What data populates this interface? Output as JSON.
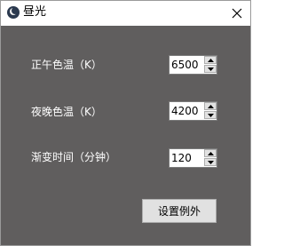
{
  "window": {
    "title": "昼光",
    "app_icon": "moon-icon",
    "close_icon": "close-icon"
  },
  "settings": {
    "noon_temp": {
      "label": "正午色温（K）",
      "value": "6500"
    },
    "night_temp": {
      "label": "夜晚色温（K）",
      "value": "4200"
    },
    "transition_time": {
      "label": "渐变时间（分钟）",
      "value": "120"
    }
  },
  "buttons": {
    "exceptions": "设置例外"
  },
  "colors": {
    "client_background": "#605e5e",
    "label_text": "#ffffff",
    "button_face": "#e1e1e1"
  }
}
